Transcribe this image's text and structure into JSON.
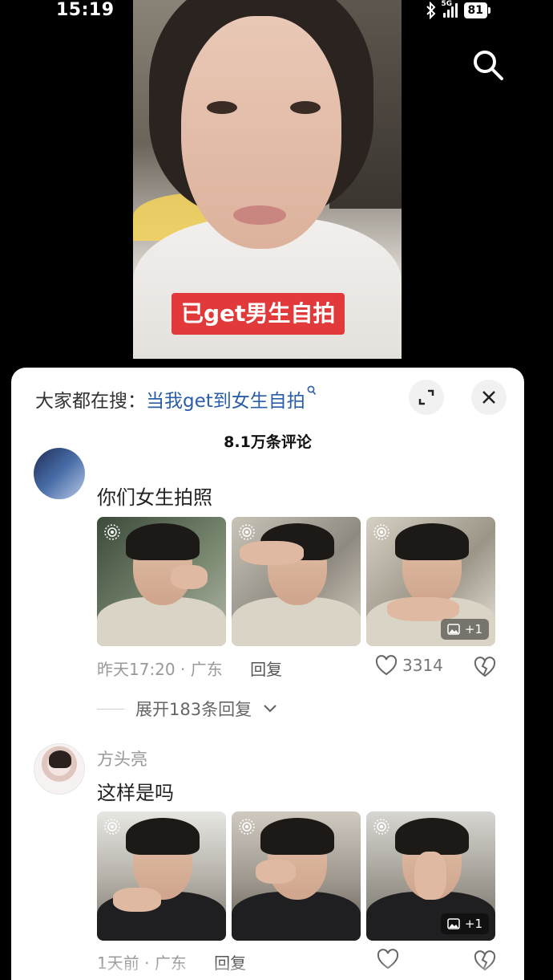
{
  "status_bar": {
    "time": "15:19",
    "network": "5G",
    "battery": "81"
  },
  "video": {
    "caption": "已get男生自拍"
  },
  "panel": {
    "search_prefix": "大家都在搜：",
    "search_query": "当我get到女生自拍",
    "comment_count": "8.1万条评论"
  },
  "comments": [
    {
      "text": "你们女生拍照",
      "time": "昨天17:20",
      "location": "广东",
      "reply_label": "回复",
      "likes": "3314",
      "extra_images": "+1",
      "expand_label": "展开183条回复"
    },
    {
      "username": "方头亮",
      "text": "这样是吗",
      "time": "1天前",
      "location": "广东",
      "reply_label": "回复",
      "extra_images": "+1"
    }
  ],
  "colors": {
    "caption_bg": "#e2393a",
    "link": "#2a5ea8",
    "panel_bg": "#ffffff"
  }
}
